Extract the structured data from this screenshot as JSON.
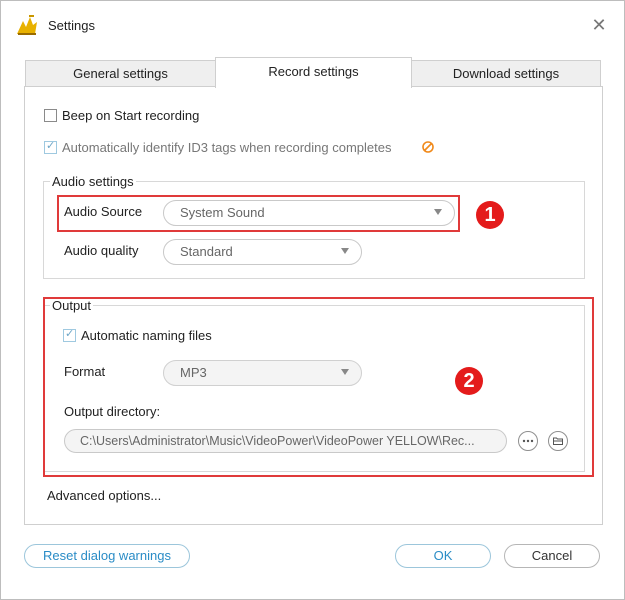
{
  "window": {
    "title": "Settings"
  },
  "tabs": [
    {
      "label": "General settings"
    },
    {
      "label": "Record settings"
    },
    {
      "label": "Download settings"
    }
  ],
  "record": {
    "beep_label": "Beep on Start recording",
    "beep_checked": false,
    "id3_label": "Automatically identify ID3 tags when recording completes",
    "id3_checked": true
  },
  "audio": {
    "group_title": "Audio settings",
    "source_label": "Audio Source",
    "source_value": "System Sound",
    "quality_label": "Audio quality",
    "quality_value": "Standard"
  },
  "output": {
    "group_title": "Output",
    "auto_naming_label": "Automatic naming files",
    "auto_naming_checked": true,
    "format_label": "Format",
    "format_value": "MP3",
    "directory_label": "Output directory:",
    "directory_value": "C:\\Users\\Administrator\\Music\\VideoPower\\VideoPower YELLOW\\Rec..."
  },
  "advanced_label": "Advanced options...",
  "annotations": [
    "1",
    "2"
  ],
  "footer": {
    "reset_label": "Reset dialog warnings",
    "ok_label": "OK",
    "cancel_label": "Cancel"
  },
  "colors": {
    "highlight_red": "#e03a3a",
    "badge_red": "#e41b1b",
    "accent_blue": "#2a8cc6"
  }
}
